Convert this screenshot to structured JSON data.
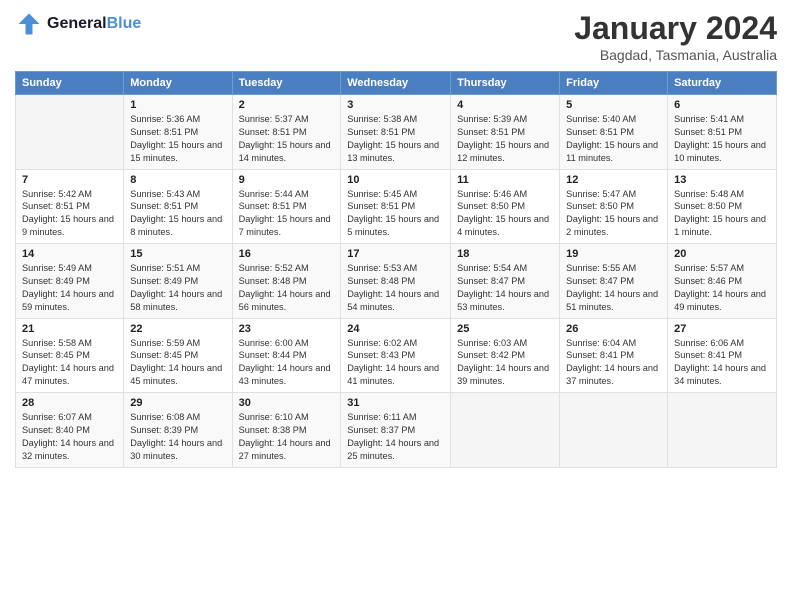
{
  "header": {
    "logo_general": "General",
    "logo_blue": "Blue",
    "main_title": "January 2024",
    "subtitle": "Bagdad, Tasmania, Australia"
  },
  "columns": [
    "Sunday",
    "Monday",
    "Tuesday",
    "Wednesday",
    "Thursday",
    "Friday",
    "Saturday"
  ],
  "weeks": [
    {
      "days": [
        {
          "num": "",
          "sunrise": "",
          "sunset": "",
          "daylight": "",
          "empty": true
        },
        {
          "num": "1",
          "sunrise": "Sunrise: 5:36 AM",
          "sunset": "Sunset: 8:51 PM",
          "daylight": "Daylight: 15 hours and 15 minutes."
        },
        {
          "num": "2",
          "sunrise": "Sunrise: 5:37 AM",
          "sunset": "Sunset: 8:51 PM",
          "daylight": "Daylight: 15 hours and 14 minutes."
        },
        {
          "num": "3",
          "sunrise": "Sunrise: 5:38 AM",
          "sunset": "Sunset: 8:51 PM",
          "daylight": "Daylight: 15 hours and 13 minutes."
        },
        {
          "num": "4",
          "sunrise": "Sunrise: 5:39 AM",
          "sunset": "Sunset: 8:51 PM",
          "daylight": "Daylight: 15 hours and 12 minutes."
        },
        {
          "num": "5",
          "sunrise": "Sunrise: 5:40 AM",
          "sunset": "Sunset: 8:51 PM",
          "daylight": "Daylight: 15 hours and 11 minutes."
        },
        {
          "num": "6",
          "sunrise": "Sunrise: 5:41 AM",
          "sunset": "Sunset: 8:51 PM",
          "daylight": "Daylight: 15 hours and 10 minutes."
        }
      ]
    },
    {
      "days": [
        {
          "num": "7",
          "sunrise": "Sunrise: 5:42 AM",
          "sunset": "Sunset: 8:51 PM",
          "daylight": "Daylight: 15 hours and 9 minutes."
        },
        {
          "num": "8",
          "sunrise": "Sunrise: 5:43 AM",
          "sunset": "Sunset: 8:51 PM",
          "daylight": "Daylight: 15 hours and 8 minutes."
        },
        {
          "num": "9",
          "sunrise": "Sunrise: 5:44 AM",
          "sunset": "Sunset: 8:51 PM",
          "daylight": "Daylight: 15 hours and 7 minutes."
        },
        {
          "num": "10",
          "sunrise": "Sunrise: 5:45 AM",
          "sunset": "Sunset: 8:51 PM",
          "daylight": "Daylight: 15 hours and 5 minutes."
        },
        {
          "num": "11",
          "sunrise": "Sunrise: 5:46 AM",
          "sunset": "Sunset: 8:50 PM",
          "daylight": "Daylight: 15 hours and 4 minutes."
        },
        {
          "num": "12",
          "sunrise": "Sunrise: 5:47 AM",
          "sunset": "Sunset: 8:50 PM",
          "daylight": "Daylight: 15 hours and 2 minutes."
        },
        {
          "num": "13",
          "sunrise": "Sunrise: 5:48 AM",
          "sunset": "Sunset: 8:50 PM",
          "daylight": "Daylight: 15 hours and 1 minute."
        }
      ]
    },
    {
      "days": [
        {
          "num": "14",
          "sunrise": "Sunrise: 5:49 AM",
          "sunset": "Sunset: 8:49 PM",
          "daylight": "Daylight: 14 hours and 59 minutes."
        },
        {
          "num": "15",
          "sunrise": "Sunrise: 5:51 AM",
          "sunset": "Sunset: 8:49 PM",
          "daylight": "Daylight: 14 hours and 58 minutes."
        },
        {
          "num": "16",
          "sunrise": "Sunrise: 5:52 AM",
          "sunset": "Sunset: 8:48 PM",
          "daylight": "Daylight: 14 hours and 56 minutes."
        },
        {
          "num": "17",
          "sunrise": "Sunrise: 5:53 AM",
          "sunset": "Sunset: 8:48 PM",
          "daylight": "Daylight: 14 hours and 54 minutes."
        },
        {
          "num": "18",
          "sunrise": "Sunrise: 5:54 AM",
          "sunset": "Sunset: 8:47 PM",
          "daylight": "Daylight: 14 hours and 53 minutes."
        },
        {
          "num": "19",
          "sunrise": "Sunrise: 5:55 AM",
          "sunset": "Sunset: 8:47 PM",
          "daylight": "Daylight: 14 hours and 51 minutes."
        },
        {
          "num": "20",
          "sunrise": "Sunrise: 5:57 AM",
          "sunset": "Sunset: 8:46 PM",
          "daylight": "Daylight: 14 hours and 49 minutes."
        }
      ]
    },
    {
      "days": [
        {
          "num": "21",
          "sunrise": "Sunrise: 5:58 AM",
          "sunset": "Sunset: 8:45 PM",
          "daylight": "Daylight: 14 hours and 47 minutes."
        },
        {
          "num": "22",
          "sunrise": "Sunrise: 5:59 AM",
          "sunset": "Sunset: 8:45 PM",
          "daylight": "Daylight: 14 hours and 45 minutes."
        },
        {
          "num": "23",
          "sunrise": "Sunrise: 6:00 AM",
          "sunset": "Sunset: 8:44 PM",
          "daylight": "Daylight: 14 hours and 43 minutes."
        },
        {
          "num": "24",
          "sunrise": "Sunrise: 6:02 AM",
          "sunset": "Sunset: 8:43 PM",
          "daylight": "Daylight: 14 hours and 41 minutes."
        },
        {
          "num": "25",
          "sunrise": "Sunrise: 6:03 AM",
          "sunset": "Sunset: 8:42 PM",
          "daylight": "Daylight: 14 hours and 39 minutes."
        },
        {
          "num": "26",
          "sunrise": "Sunrise: 6:04 AM",
          "sunset": "Sunset: 8:41 PM",
          "daylight": "Daylight: 14 hours and 37 minutes."
        },
        {
          "num": "27",
          "sunrise": "Sunrise: 6:06 AM",
          "sunset": "Sunset: 8:41 PM",
          "daylight": "Daylight: 14 hours and 34 minutes."
        }
      ]
    },
    {
      "days": [
        {
          "num": "28",
          "sunrise": "Sunrise: 6:07 AM",
          "sunset": "Sunset: 8:40 PM",
          "daylight": "Daylight: 14 hours and 32 minutes."
        },
        {
          "num": "29",
          "sunrise": "Sunrise: 6:08 AM",
          "sunset": "Sunset: 8:39 PM",
          "daylight": "Daylight: 14 hours and 30 minutes."
        },
        {
          "num": "30",
          "sunrise": "Sunrise: 6:10 AM",
          "sunset": "Sunset: 8:38 PM",
          "daylight": "Daylight: 14 hours and 27 minutes."
        },
        {
          "num": "31",
          "sunrise": "Sunrise: 6:11 AM",
          "sunset": "Sunset: 8:37 PM",
          "daylight": "Daylight: 14 hours and 25 minutes."
        },
        {
          "num": "",
          "sunrise": "",
          "sunset": "",
          "daylight": "",
          "empty": true
        },
        {
          "num": "",
          "sunrise": "",
          "sunset": "",
          "daylight": "",
          "empty": true
        },
        {
          "num": "",
          "sunrise": "",
          "sunset": "",
          "daylight": "",
          "empty": true
        }
      ]
    }
  ]
}
